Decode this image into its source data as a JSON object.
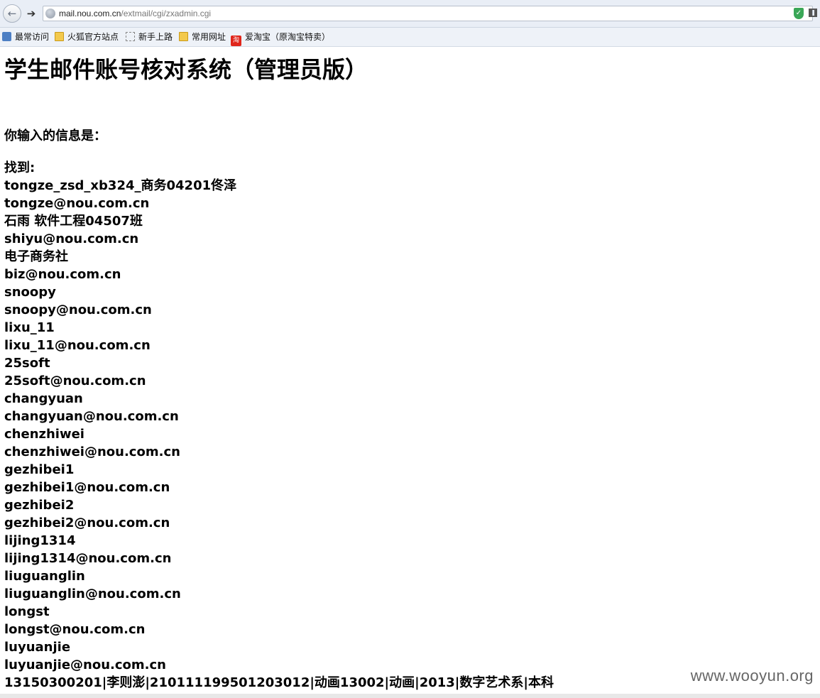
{
  "browser": {
    "url_host": "mail.nou.com.cn",
    "url_path": "/extmail/cgi/zxadmin.cgi",
    "bookmarks": [
      "最常访问",
      "火狐官方站点",
      "新手上路",
      "常用网址",
      "爱淘宝（原淘宝特卖）"
    ],
    "taobao_icon_glyph": "淘"
  },
  "page": {
    "title": "学生邮件账号核对系统（管理员版）",
    "input_label": "你输入的信息是：",
    "found_label": "找到:",
    "results": [
      "tongze_zsd_xb324_商务04201佟泽",
      "tongze@nou.com.cn",
      "石雨 软件工程04507班",
      "shiyu@nou.com.cn",
      "电子商务社",
      "biz@nou.com.cn",
      "snoopy",
      "snoopy@nou.com.cn",
      "lixu_11",
      "lixu_11@nou.com.cn",
      "25soft",
      "25soft@nou.com.cn",
      "changyuan",
      "changyuan@nou.com.cn",
      "chenzhiwei",
      "chenzhiwei@nou.com.cn",
      "gezhibei1",
      "gezhibei1@nou.com.cn",
      "gezhibei2",
      "gezhibei2@nou.com.cn",
      "lijing1314",
      "lijing1314@nou.com.cn",
      "liuguanglin",
      "liuguanglin@nou.com.cn",
      "longst",
      "longst@nou.com.cn",
      "luyuanjie",
      "luyuanjie@nou.com.cn",
      "13150300201|李则澎|210111199501203012|动画13002|动画|2013|数字艺术系|本科"
    ]
  },
  "watermark": "www.wooyun.org"
}
